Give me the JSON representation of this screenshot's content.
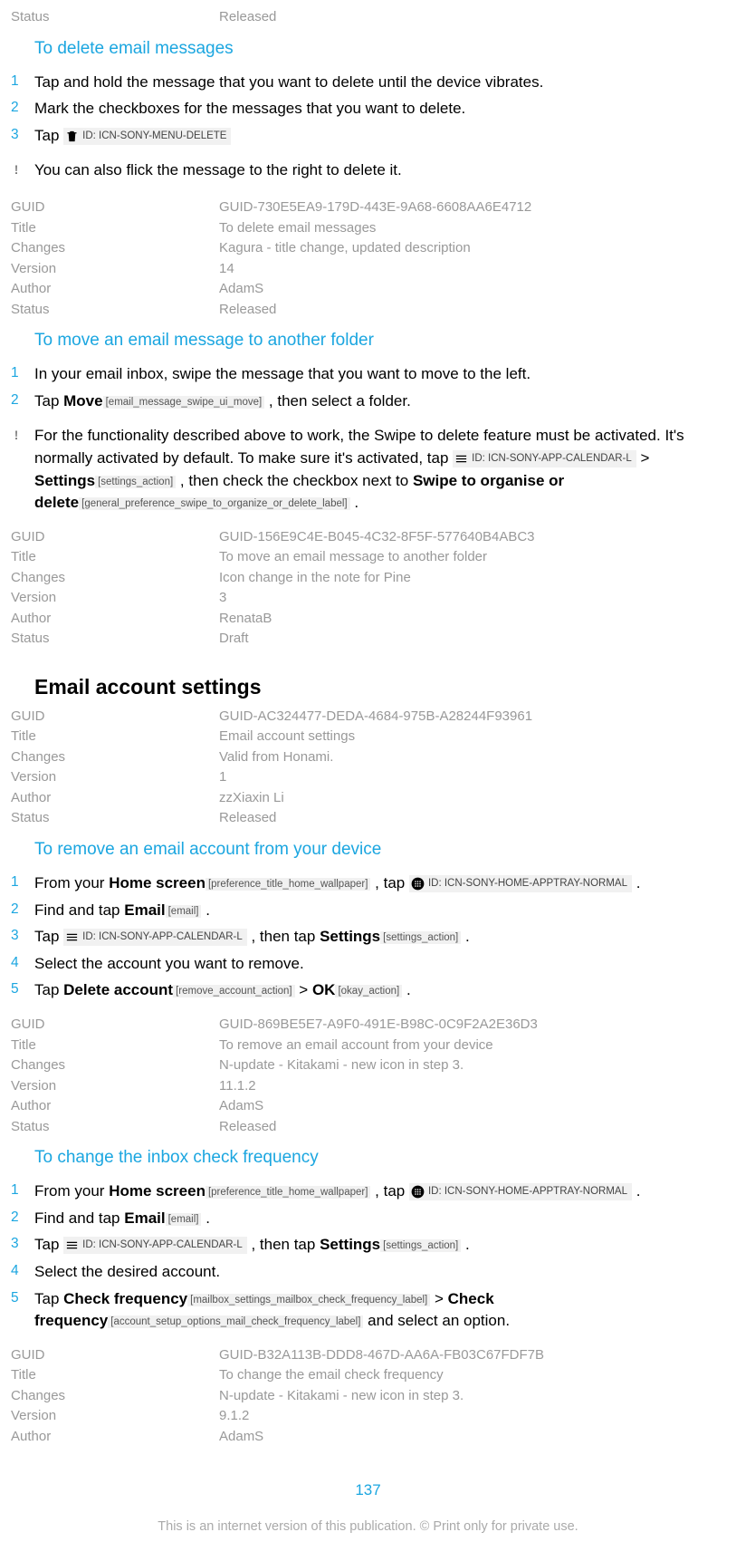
{
  "meta0": {
    "Status": "Released"
  },
  "s1": {
    "heading": "To delete email messages",
    "steps": {
      "1": "Tap and hold the message that you want to delete until the device vibrates.",
      "2": "Mark the checkboxes for the messages that you want to delete.",
      "3_a": "Tap ",
      "3_icon": "ID: ICN-SONY-MENU-DELETE"
    },
    "note": "You can also flick the message to the right to delete it.",
    "meta": {
      "GUID": "GUID-730E5EA9-179D-443E-9A68-6608AA6E4712",
      "Title": "To delete email messages",
      "Changes": "Kagura - title change, updated description",
      "Version": "14",
      "Author": "AdamS",
      "Status": "Released"
    }
  },
  "s2": {
    "heading": "To move an email message to another folder",
    "steps": {
      "1": "In your email inbox, swipe the message that you want to move to the left.",
      "2_a": "Tap ",
      "2_b": "Move",
      "2_tag": "[email_message_swipe_ui_move]",
      "2_c": " , then select a folder."
    },
    "note_a": "For the functionality described above to work, the Swipe to delete feature must be activated. It's normally activated by default. To make sure it's activated, tap ",
    "note_icon": "ID: ICN-SONY-APP-CALENDAR-L",
    "note_b": " > ",
    "note_c": "Settings",
    "note_tag1": "[settings_action]",
    "note_d": " , then check the checkbox next to ",
    "note_e": "Swipe to organise or delete",
    "note_tag2": "[general_preference_swipe_to_organize_or_delete_label]",
    "note_f": " .",
    "meta": {
      "GUID": "GUID-156E9C4E-B045-4C32-8F5F-577640B4ABC3",
      "Title": "To move an email message to another folder",
      "Changes": "Icon change in the note for Pine",
      "Version": "3",
      "Author": "RenataB",
      "Status": "Draft"
    }
  },
  "s3": {
    "heading": "Email account settings",
    "meta": {
      "GUID": "GUID-AC324477-DEDA-4684-975B-A28244F93961",
      "Title": "Email account settings",
      "Changes": "Valid from Honami.",
      "Version": "1",
      "Author": "zzXiaxin Li",
      "Status": "Released"
    }
  },
  "s4": {
    "heading": "To remove an email account from your device",
    "steps": {
      "1_a": "From your ",
      "1_b": "Home screen",
      "1_tag1": "[preference_title_home_wallpaper]",
      "1_c": " , tap ",
      "1_icon": "ID: ICN-SONY-HOME-APPTRAY-NORMAL",
      "1_d": " .",
      "2_a": "Find and tap ",
      "2_b": "Email",
      "2_tag": "[email]",
      "2_c": " .",
      "3_a": "Tap ",
      "3_icon": "ID: ICN-SONY-APP-CALENDAR-L",
      "3_b": " , then tap ",
      "3_c": "Settings",
      "3_tag": "[settings_action]",
      "3_d": " .",
      "4": "Select the account you want to remove.",
      "5_a": "Tap ",
      "5_b": "Delete account",
      "5_tag1": "[remove_account_action]",
      "5_c": " > ",
      "5_d": "OK",
      "5_tag2": "[okay_action]",
      "5_e": " ."
    },
    "meta": {
      "GUID": "GUID-869BE5E7-A9F0-491E-B98C-0C9F2A2E36D3",
      "Title": "To remove an email account from your device",
      "Changes": "N-update - Kitakami - new icon in step 3.",
      "Version": "11.1.2",
      "Author": "AdamS",
      "Status": "Released"
    }
  },
  "s5": {
    "heading": "To change the inbox check frequency",
    "steps": {
      "1_a": "From your ",
      "1_b": "Home screen",
      "1_tag1": "[preference_title_home_wallpaper]",
      "1_c": " , tap ",
      "1_icon": "ID: ICN-SONY-HOME-APPTRAY-NORMAL",
      "1_d": " .",
      "2_a": "Find and tap ",
      "2_b": "Email",
      "2_tag": "[email]",
      "2_c": " .",
      "3_a": "Tap ",
      "3_icon": "ID: ICN-SONY-APP-CALENDAR-L",
      "3_b": " , then tap ",
      "3_c": "Settings",
      "3_tag": "[settings_action]",
      "3_d": " .",
      "4": "Select the desired account.",
      "5_a": "Tap ",
      "5_b": "Check frequency",
      "5_tag1": "[mailbox_settings_mailbox_check_frequency_label]",
      "5_c": " > ",
      "5_d": "Check frequency",
      "5_tag2": "[account_setup_options_mail_check_frequency_label]",
      "5_e": " and select an option."
    },
    "meta": {
      "GUID": "GUID-B32A113B-DDD8-467D-AA6A-FB03C67FDF7B",
      "Title": "To change the email check frequency",
      "Changes": "N-update - Kitakami - new icon in step 3.",
      "Version": "9.1.2",
      "Author": "AdamS"
    }
  },
  "page_number": "137",
  "footer_text": "This is an internet version of this publication. © Print only for private use."
}
